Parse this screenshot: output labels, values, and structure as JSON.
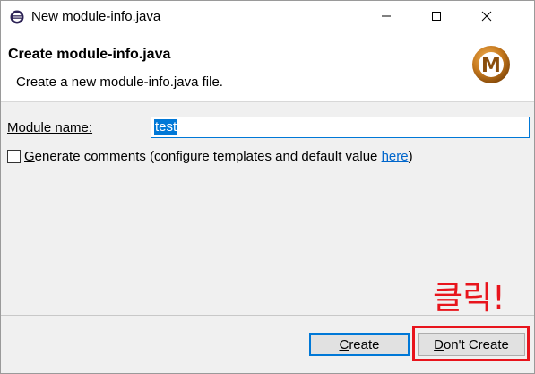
{
  "window": {
    "title": "New module-info.java",
    "controls": {
      "minimize": "minimize-icon",
      "maximize": "maximize-icon",
      "close": "close-icon"
    }
  },
  "banner": {
    "title": "Create module-info.java",
    "description": "Create a new module-info.java file.",
    "logo_letter": "M"
  },
  "form": {
    "module_name_label": "Module name:",
    "module_name_value": "test",
    "generate_comments": {
      "checked": false,
      "label_G": "G",
      "label_rest": "enerate comments (configure templates and default value ",
      "link": "here",
      "closing": ")"
    }
  },
  "buttons": {
    "create": {
      "mnemonic": "C",
      "rest": "reate"
    },
    "dont_create": {
      "mnemonic": "D",
      "rest": "on't Create"
    }
  },
  "annotation": {
    "text": "클릭!",
    "color": "#e8141c"
  },
  "colors": {
    "accent": "#0078d7",
    "link": "#0066cc"
  }
}
